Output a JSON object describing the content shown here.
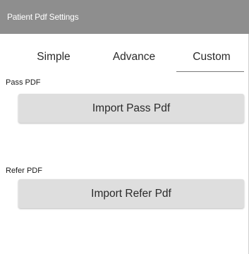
{
  "window": {
    "title": "Patient Pdf Settings"
  },
  "tabs": [
    {
      "label": "Simple",
      "selected": false
    },
    {
      "label": "Advance",
      "selected": false
    },
    {
      "label": "Custom",
      "selected": true
    }
  ],
  "pass_pdf": {
    "label": "Pass PDF",
    "button_label": "Import Pass Pdf"
  },
  "refer_pdf": {
    "label": "Refer PDF",
    "button_label": "Import Refer Pdf"
  },
  "colors": {
    "title_bar_bg": "#8e8e8e",
    "button_bg": "#dedede",
    "selected_tab_underline": "#7a7a7a"
  }
}
